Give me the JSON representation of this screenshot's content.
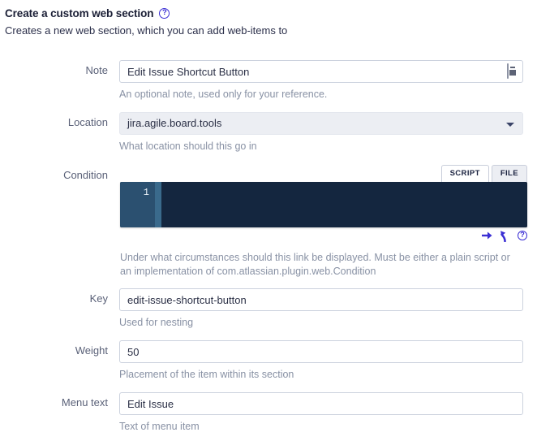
{
  "header": {
    "title": "Create a custom web section",
    "help_icon": "question-circle-icon",
    "subtitle": "Creates a new web section, which you can add web-items to"
  },
  "form": {
    "note": {
      "label": "Note",
      "value": "Edit Issue Shortcut Button",
      "placeholder": "",
      "hint": "An optional note, used only for your reference.",
      "trailing_icon": "document-picker-icon"
    },
    "location": {
      "label": "Location",
      "value": "jira.agile.board.tools",
      "hint": "What location should this go in",
      "caret_icon": "chevron-down-icon"
    },
    "condition": {
      "label": "Condition",
      "tabs": [
        {
          "label": "SCRIPT",
          "active": true
        },
        {
          "label": "FILE",
          "active": false
        }
      ],
      "line_number": "1",
      "code": "",
      "actions": [
        {
          "icon": "arrow-right-icon"
        },
        {
          "icon": "arrow-curve-up-icon"
        },
        {
          "icon": "question-circle-icon"
        }
      ],
      "hint": "Under what circumstances should this link be displayed. Must be either a plain script or an implementation of com.atlassian.plugin.web.Condition"
    },
    "key": {
      "label": "Key",
      "value": "edit-issue-shortcut-button",
      "hint": "Used for nesting"
    },
    "weight": {
      "label": "Weight",
      "value": "50",
      "hint": "Placement of the item within its section"
    },
    "menu_text": {
      "label": "Menu text",
      "value": "Edit Issue",
      "hint": "Text of menu item"
    }
  },
  "colors": {
    "accent": "#3b2fd4",
    "editor_bg": "#14263f",
    "editor_gutter": "#2b5070",
    "label": "#5a6178",
    "hint": "#8891a4"
  }
}
